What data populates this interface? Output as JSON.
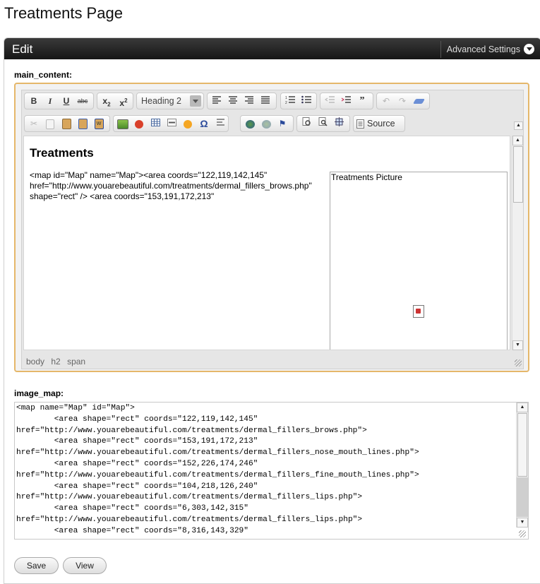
{
  "page": {
    "title": "Treatments Page"
  },
  "panel": {
    "title": "Edit",
    "advanced_settings": "Advanced Settings"
  },
  "fields": {
    "main_content_label": "main_content:",
    "image_map_label": "image_map:"
  },
  "toolbar": {
    "format_value": "Heading 2",
    "source_label": "Source"
  },
  "editor": {
    "heading": "Treatments",
    "body": "<map id=\"Map\" name=\"Map\"><area coords=\"122,119,142,145\" href=\"http://www.youarebeautiful.com/treatments/dermal_fillers_brows.php\" shape=\"rect\" /> <area coords=\"153,191,172,213\"",
    "picture_label": "Treatments Picture",
    "path": [
      "body",
      "h2",
      "span"
    ]
  },
  "image_map": {
    "value": "<map name=\"Map\" id=\"Map\">\n        <area shape=\"rect\" coords=\"122,119,142,145\"\nhref=\"http://www.youarebeautiful.com/treatments/dermal_fillers_brows.php\">\n        <area shape=\"rect\" coords=\"153,191,172,213\"\nhref=\"http://www.youarebeautiful.com/treatments/dermal_fillers_nose_mouth_lines.php\">\n        <area shape=\"rect\" coords=\"152,226,174,246\"\nhref=\"http://www.youarebeautiful.com/treatments/dermal_fillers_fine_mouth_lines.php\">\n        <area shape=\"rect\" coords=\"104,218,126,240\"\nhref=\"http://www.youarebeautiful.com/treatments/dermal_fillers_lips.php\">\n        <area shape=\"rect\" coords=\"6,303,142,315\"\nhref=\"http://www.youarebeautiful.com/treatments/dermal_fillers_lips.php\">\n        <area shape=\"rect\" coords=\"8,316,143,329\""
  },
  "actions": {
    "save": "Save",
    "view": "View"
  }
}
